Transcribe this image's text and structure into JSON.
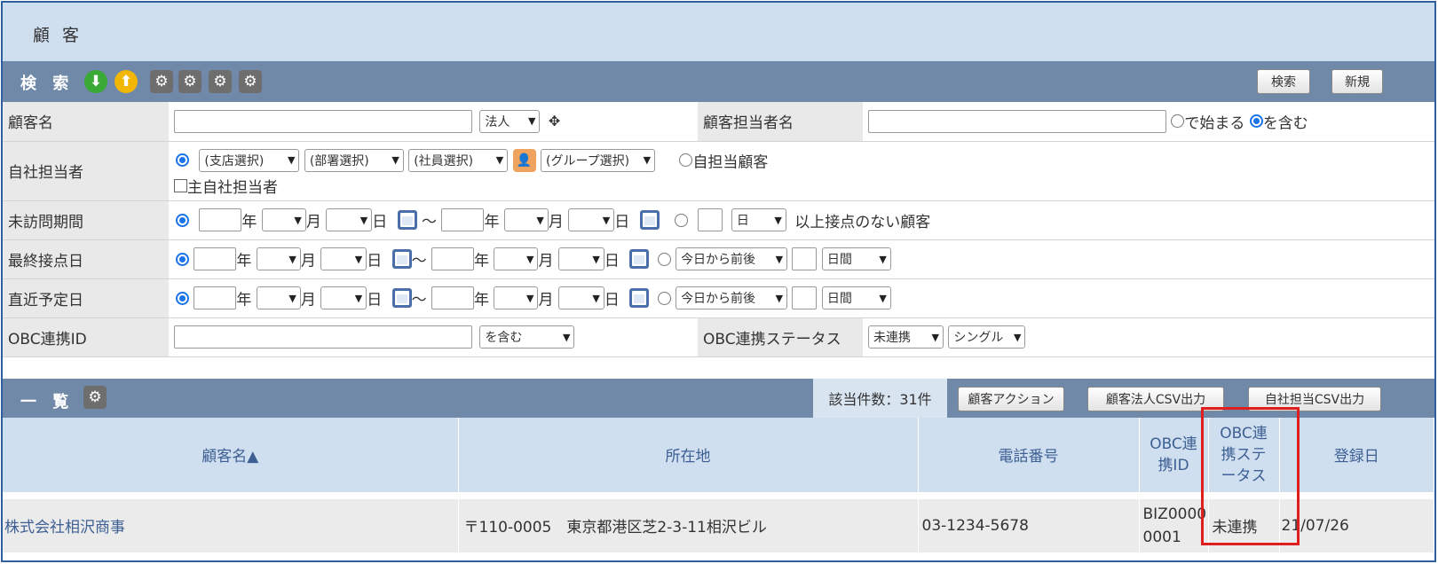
{
  "page_title": "顧 客",
  "search": {
    "title": "検 索",
    "search_button": "検索",
    "new_button": "新規",
    "rows": {
      "customer_name": {
        "label": "顧客名",
        "type_select": "法人"
      },
      "customer_rep": {
        "label": "顧客担当者名",
        "opt_starts": "で始まる",
        "opt_contains": "を含む"
      },
      "own_rep": {
        "label": "自社担当者",
        "branch": "(支店選択)",
        "dept": "(部署選択)",
        "employee": "(社員選択)",
        "group": "(グループ選択)",
        "own_customer": "自担当顧客",
        "main_rep": "主自社担当者"
      },
      "unvisited": {
        "label": "未訪問期間",
        "year": "年",
        "month": "月",
        "day": "日",
        "tilde": "〜",
        "unit_select": "日",
        "suffix": "以上接点のない顧客"
      },
      "last_contact": {
        "label": "最終接点日",
        "year": "年",
        "month": "月",
        "day": "日",
        "tilde": "〜",
        "relative": "今日から前後",
        "period": "日間"
      },
      "next_planned": {
        "label": "直近予定日",
        "year": "年",
        "month": "月",
        "day": "日",
        "tilde": "〜",
        "relative": "今日から前後",
        "period": "日間"
      },
      "obc_id": {
        "label": "OBC連携ID",
        "match_select": "を含む",
        "status_label": "OBC連携ステータス",
        "status_select": "未連携",
        "mode_select": "シングル"
      }
    }
  },
  "list": {
    "title": "一 覧",
    "count": "該当件数：31件",
    "action_button": "顧客アクション",
    "csv_corp_button": "顧客法人CSV出力",
    "csv_own_button": "自社担当CSV出力",
    "columns": {
      "name": "顧客名▲",
      "address": "所在地",
      "phone": "電話番号",
      "obc_id": "OBC連携ID",
      "obc_status": "OBC連携ステータス",
      "registered": "登録日"
    },
    "rows": [
      {
        "name": "株式会社相沢商事",
        "address": "〒110-0005　東京都港区芝2-3-11相沢ビル",
        "phone": "03-1234-5678",
        "obc_id": "BIZ00000001",
        "obc_status": "未連携",
        "registered": "21/07/26"
      }
    ]
  }
}
